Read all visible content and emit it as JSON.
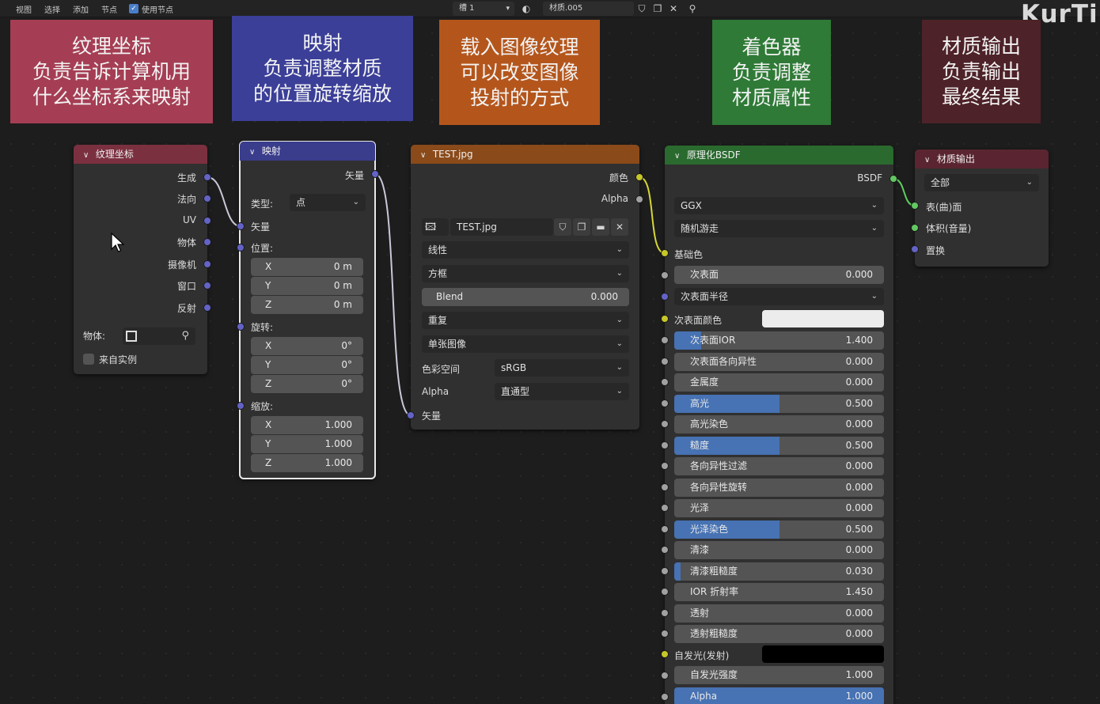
{
  "header": {
    "menu": [
      "视图",
      "选择",
      "添加",
      "节点"
    ],
    "use_nodes_label": "使用节点",
    "use_nodes_checked": true,
    "slot": "槽 1",
    "material_name": "材质.005"
  },
  "watermark": "KurTip",
  "annotations": [
    {
      "lines": [
        "纹理坐标",
        "负责告诉计算机用",
        "什么坐标系来映射"
      ],
      "color": "#a53e54"
    },
    {
      "lines": [
        "映射",
        "负责调整材质",
        "的位置旋转缩放"
      ],
      "color": "#3b3f98"
    },
    {
      "lines": [
        "载入图像纹理",
        "可以改变图像",
        "投射的方式"
      ],
      "color": "#b4561c"
    },
    {
      "lines": [
        "着色器",
        "负责调整",
        "材质属性"
      ],
      "color": "#2e7a36"
    },
    {
      "lines": [
        "材质输出",
        "负责输出",
        "最终结果"
      ],
      "color": "#4d2228"
    }
  ],
  "texcoord": {
    "title": "纹理坐标",
    "header_color": "#7b3040",
    "outputs": [
      "生成",
      "法向",
      "UV",
      "物体",
      "摄像机",
      "窗口",
      "反射"
    ],
    "object_label": "物体:",
    "from_instancer": "来自实例"
  },
  "mapping": {
    "title": "映射",
    "header_color": "#3a3c8c",
    "output": "矢量",
    "type_label": "类型:",
    "type_value": "点",
    "vector_input": "矢量",
    "location_label": "位置:",
    "location": [
      {
        "axis": "X",
        "value": "0 m"
      },
      {
        "axis": "Y",
        "value": "0 m"
      },
      {
        "axis": "Z",
        "value": "0 m"
      }
    ],
    "rotation_label": "旋转:",
    "rotation": [
      {
        "axis": "X",
        "value": "0°"
      },
      {
        "axis": "Y",
        "value": "0°"
      },
      {
        "axis": "Z",
        "value": "0°"
      }
    ],
    "scale_label": "缩放:",
    "scale": [
      {
        "axis": "X",
        "value": "1.000"
      },
      {
        "axis": "Y",
        "value": "1.000"
      },
      {
        "axis": "Z",
        "value": "1.000"
      }
    ]
  },
  "image": {
    "title": "TEST.jpg",
    "header_color": "#8a4a1a",
    "out_color": "颜色",
    "out_alpha": "Alpha",
    "image_name": "TEST.jpg",
    "interpolation": "线性",
    "projection": "方框",
    "blend_label": "Blend",
    "blend_value": "0.000",
    "extension": "重复",
    "source": "单张图像",
    "colorspace_label": "色彩空间",
    "colorspace_value": "sRGB",
    "alpha_label": "Alpha",
    "alpha_value": "直通型",
    "vector_input": "矢量"
  },
  "bsdf": {
    "title": "原理化BSDF",
    "header_color": "#2a6a2e",
    "output": "BSDF",
    "distribution": "GGX",
    "subsurface_method": "随机游走",
    "base_color_label": "基础色",
    "subsurface_label": "次表面",
    "subsurface_value": "0.000",
    "subsurface_radius": "次表面半径",
    "subsurface_color_label": "次表面颜色",
    "subsurface_color": "#ececec",
    "fields": [
      {
        "label": "次表面IOR",
        "value": "1.400",
        "fill": 0.13
      },
      {
        "label": "次表面各向异性",
        "value": "0.000",
        "fill": 0
      },
      {
        "label": "金属度",
        "value": "0.000",
        "fill": 0
      },
      {
        "label": "高光",
        "value": "0.500",
        "fill": 0.5
      },
      {
        "label": "高光染色",
        "value": "0.000",
        "fill": 0
      },
      {
        "label": "糙度",
        "value": "0.500",
        "fill": 0.5
      },
      {
        "label": "各向异性过滤",
        "value": "0.000",
        "fill": 0
      },
      {
        "label": "各向异性旋转",
        "value": "0.000",
        "fill": 0
      },
      {
        "label": "光泽",
        "value": "0.000",
        "fill": 0
      },
      {
        "label": "光泽染色",
        "value": "0.500",
        "fill": 0.5
      },
      {
        "label": "清漆",
        "value": "0.000",
        "fill": 0
      },
      {
        "label": "清漆粗糙度",
        "value": "0.030",
        "fill": 0.03
      },
      {
        "label": "IOR 折射率",
        "value": "1.450",
        "fill": 0
      },
      {
        "label": "透射",
        "value": "0.000",
        "fill": 0
      },
      {
        "label": "透射粗糙度",
        "value": "0.000",
        "fill": 0
      }
    ],
    "emission_label": "自发光(发射)",
    "emission_color": "#000000",
    "emission_strength_label": "自发光强度",
    "emission_strength_value": "1.000",
    "alpha_label": "Alpha",
    "alpha_value": "1.000",
    "alpha_fill": 1.0
  },
  "output": {
    "title": "材质输出",
    "header_color": "#5a2530",
    "target": "全部",
    "surface": "表(曲)面",
    "volume": "体积(音量)",
    "displacement": "置换"
  }
}
